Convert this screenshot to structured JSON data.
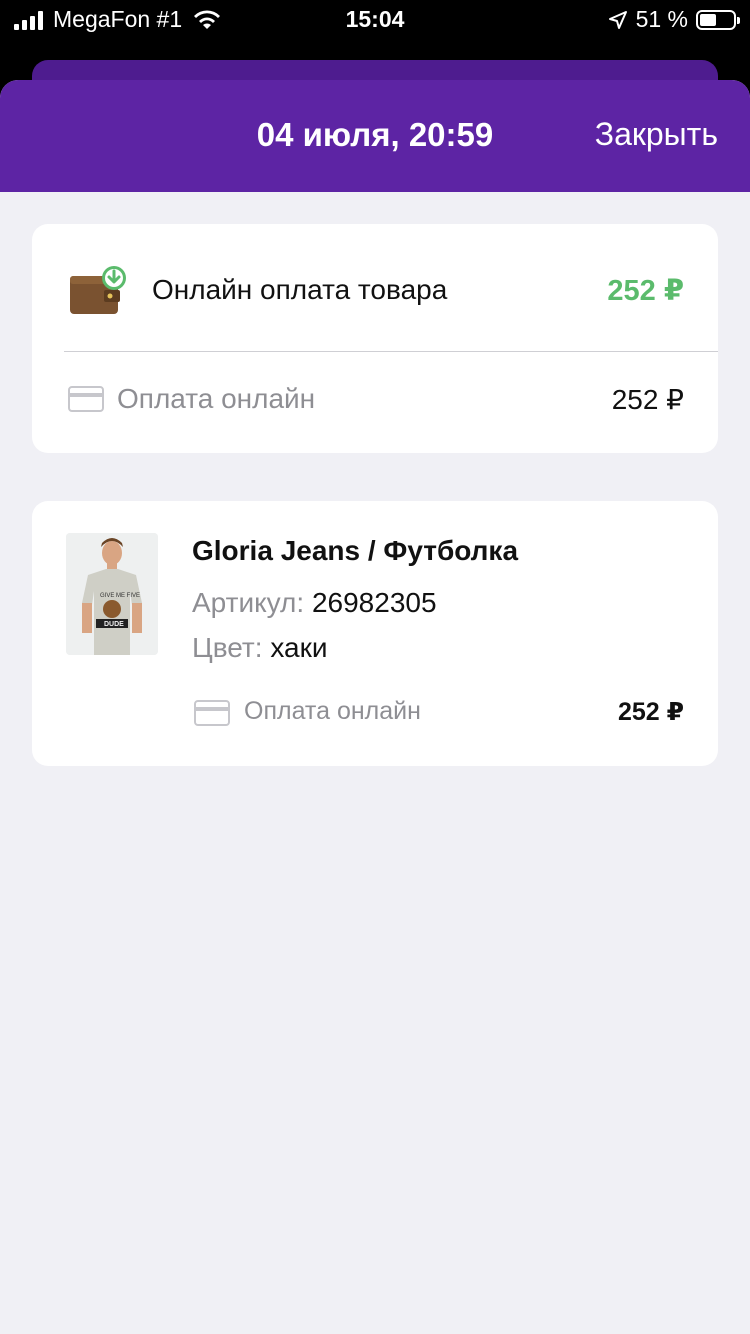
{
  "status_bar": {
    "carrier": "MegaFon #1",
    "time": "15:04",
    "battery_text": "51 %",
    "battery_level": 0.51
  },
  "header": {
    "title": "04 июля, 20:59",
    "close_label": "Закрыть"
  },
  "payment": {
    "label": "Онлайн оплата товара",
    "amount": "252 ₽",
    "method_label": "Оплата онлайн",
    "method_amount": "252 ₽",
    "amount_color": "#5bbb6c"
  },
  "item": {
    "title": "Gloria Jeans / Футболка",
    "sku_key": "Артикул:",
    "sku_value": "26982305",
    "color_key": "Цвет:",
    "color_value": "хаки",
    "method_label": "Оплата онлайн",
    "amount": "252 ₽",
    "image_icon": "product-photo",
    "shirt_text": "GIVE ME FIVE DUDE"
  },
  "colors": {
    "header": "#5d24a4",
    "background": "#f0f0f5"
  }
}
